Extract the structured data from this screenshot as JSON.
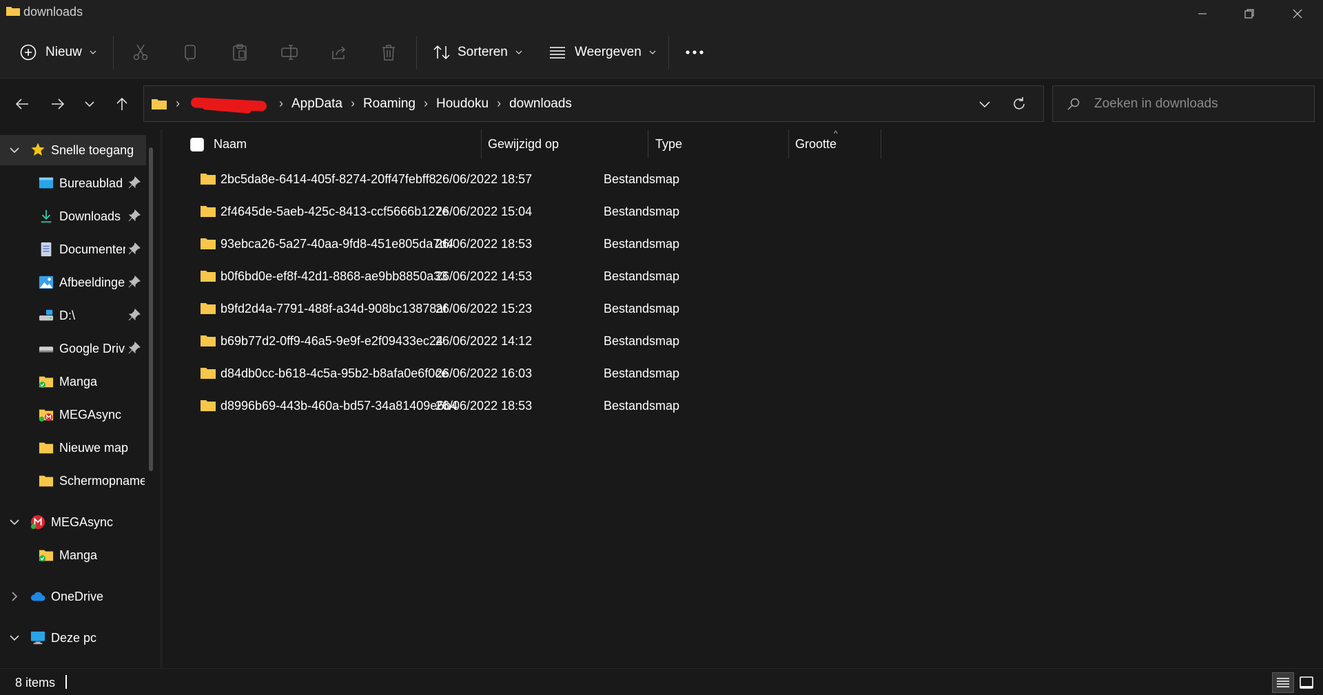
{
  "window": {
    "title": "downloads"
  },
  "toolbar": {
    "new_label": "Nieuw",
    "sort_label": "Sorteren",
    "view_label": "Weergeven"
  },
  "address": {
    "crumbs": [
      "AppData",
      "Roaming",
      "Houdoku",
      "downloads"
    ]
  },
  "search": {
    "placeholder": "Zoeken in downloads"
  },
  "sidebar": {
    "items": [
      {
        "label": "Snelle toegang",
        "icon": "star-icon",
        "pinned": false,
        "expanded": true
      },
      {
        "label": "Bureaublad",
        "icon": "desktop-icon",
        "pinned": true
      },
      {
        "label": "Downloads",
        "icon": "download-icon",
        "pinned": true
      },
      {
        "label": "Documenten",
        "icon": "document-icon",
        "pinned": true
      },
      {
        "label": "Afbeeldingen",
        "icon": "pictures-icon",
        "pinned": true
      },
      {
        "label": "D:\\",
        "icon": "drive-icon",
        "pinned": true
      },
      {
        "label": "Google Drive",
        "icon": "drive-icon",
        "pinned": true
      },
      {
        "label": "Manga",
        "icon": "sync-folder-icon",
        "pinned": false
      },
      {
        "label": "MEGAsync",
        "icon": "mega-folder-icon",
        "pinned": false
      },
      {
        "label": "Nieuwe map",
        "icon": "folder-icon",
        "pinned": false
      },
      {
        "label": "Schermopnamen",
        "icon": "folder-icon",
        "pinned": false
      },
      {
        "label": "MEGAsync",
        "icon": "mega-icon",
        "pinned": false,
        "expanded": true
      },
      {
        "label": "Manga",
        "icon": "sync-folder-icon",
        "pinned": false
      },
      {
        "label": "OneDrive",
        "icon": "cloud-icon",
        "pinned": false,
        "expanded": false
      },
      {
        "label": "Deze pc",
        "icon": "computer-icon",
        "pinned": false,
        "expanded": true
      }
    ]
  },
  "columns": {
    "name": "Naam",
    "modified": "Gewijzigd op",
    "type": "Type",
    "size": "Grootte"
  },
  "files": [
    {
      "name": "2bc5da8e-6414-405f-8274-20ff47febff8",
      "modified": "26/06/2022 18:57",
      "type": "Bestandsmap"
    },
    {
      "name": "2f4645de-5aeb-425c-8413-ccf5666b127e",
      "modified": "26/06/2022 15:04",
      "type": "Bestandsmap"
    },
    {
      "name": "93ebca26-5a27-40aa-9fd8-451e805da7d4",
      "modified": "26/06/2022 18:53",
      "type": "Bestandsmap"
    },
    {
      "name": "b0f6bd0e-ef8f-42d1-8868-ae9bb8850a33",
      "modified": "26/06/2022 14:53",
      "type": "Bestandsmap"
    },
    {
      "name": "b9fd2d4a-7791-488f-a34d-908bc13878af",
      "modified": "26/06/2022 15:23",
      "type": "Bestandsmap"
    },
    {
      "name": "b69b77d2-0ff9-46a5-9e9f-e2f09433ec24",
      "modified": "26/06/2022 14:12",
      "type": "Bestandsmap"
    },
    {
      "name": "d84db0cc-b618-4c5a-95b2-b8afa0e6f0ce",
      "modified": "26/06/2022 16:03",
      "type": "Bestandsmap"
    },
    {
      "name": "d8996b69-443b-460a-bd57-34a81409e6b4",
      "modified": "26/06/2022 18:53",
      "type": "Bestandsmap"
    }
  ],
  "status": {
    "item_count": "8 items"
  },
  "colors": {
    "folder": "#f8c74a",
    "background": "#191919",
    "chrome": "#202020"
  }
}
